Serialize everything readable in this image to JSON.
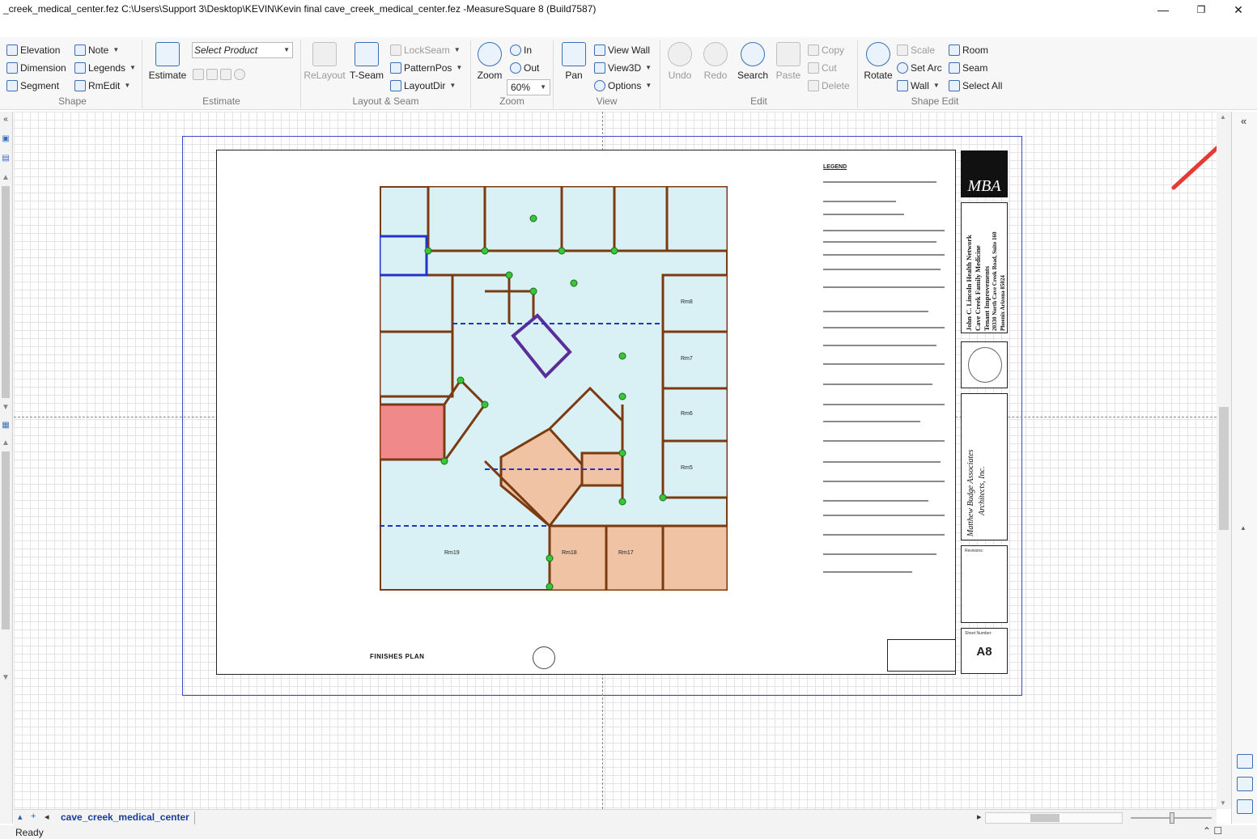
{
  "window": {
    "title": "_creek_medical_center.fez C:\\Users\\Support 3\\Desktop\\KEVIN\\Kevin final cave_creek_medical_center.fez -MeasureSquare 8 (Build7587)",
    "min_glyph": "—",
    "max_glyph": "❐",
    "close_glyph": "✕"
  },
  "ribbon": {
    "shape": {
      "label": "Shape",
      "elevation": "Elevation",
      "dimension": "Dimension",
      "segment": "Segment",
      "note": "Note",
      "legends": "Legends",
      "rmedit": "RmEdit"
    },
    "estimate": {
      "label": "Estimate",
      "estimate_btn": "Estimate",
      "product_select": "Select Product"
    },
    "layout_seam": {
      "label": "Layout & Seam",
      "relayout": "ReLayout",
      "tseam": "T-Seam",
      "lockseam": "LockSeam",
      "patternpos": "PatternPos",
      "layoutdir": "LayoutDir"
    },
    "zoom": {
      "label": "Zoom",
      "zoom_btn": "Zoom",
      "in": "In",
      "out": "Out",
      "level": "60%"
    },
    "view": {
      "label": "View",
      "pan": "Pan",
      "view_wall": "View Wall",
      "view3d": "View3D",
      "options": "Options"
    },
    "edit": {
      "label": "Edit",
      "undo": "Undo",
      "redo": "Redo",
      "search": "Search",
      "paste": "Paste",
      "copy": "Copy",
      "cut": "Cut",
      "delete": "Delete"
    },
    "shape_edit": {
      "label": "Shape Edit",
      "rotate": "Rotate",
      "scale": "Scale",
      "set_arc": "Set Arc",
      "wall": "Wall",
      "room": "Room",
      "seam": "Seam",
      "select_all": "Select All"
    }
  },
  "drawing": {
    "plan_title": "FINISHES PLAN",
    "legend_title": "LEGEND",
    "logo_text": "MBA",
    "project_lines": [
      "John C. Lincoln Health Network",
      "Cave Creek Family Medicine",
      "Tenant Improvements",
      "20330 North Cave Creek Road, Suite 160",
      "Phoenix Arizona 85024"
    ],
    "architect_lines": [
      "Matthew Budge Associates",
      "Architects, Inc."
    ],
    "revisions_label": "Revisions:",
    "sheet_number_label": "Sheet Number:",
    "sheet_number": "A8",
    "rooms": [
      {
        "label": "Rm19",
        "type": "lobby"
      },
      {
        "label": "Rm18",
        "type": "office"
      },
      {
        "label": "Rm17",
        "type": "office"
      },
      {
        "label": "Rm7",
        "type": "exam"
      },
      {
        "label": "Rm6",
        "type": "exam"
      },
      {
        "label": "Rm5",
        "type": "exam"
      },
      {
        "label": "Rm8",
        "type": "exam"
      }
    ]
  },
  "colors": {
    "room_fill": "#d9f1f4",
    "carpet_fill": "#efc3a3",
    "red_fill": "#f08a8a",
    "wall": "#7a3b12",
    "seam": "#2233cc",
    "node": "#39c639",
    "annotation": "#e53935"
  },
  "right_panel": {
    "collapse_glyph": "«"
  },
  "tabs": {
    "document": "cave_creek_medical_center"
  },
  "status": {
    "text": "Ready"
  }
}
